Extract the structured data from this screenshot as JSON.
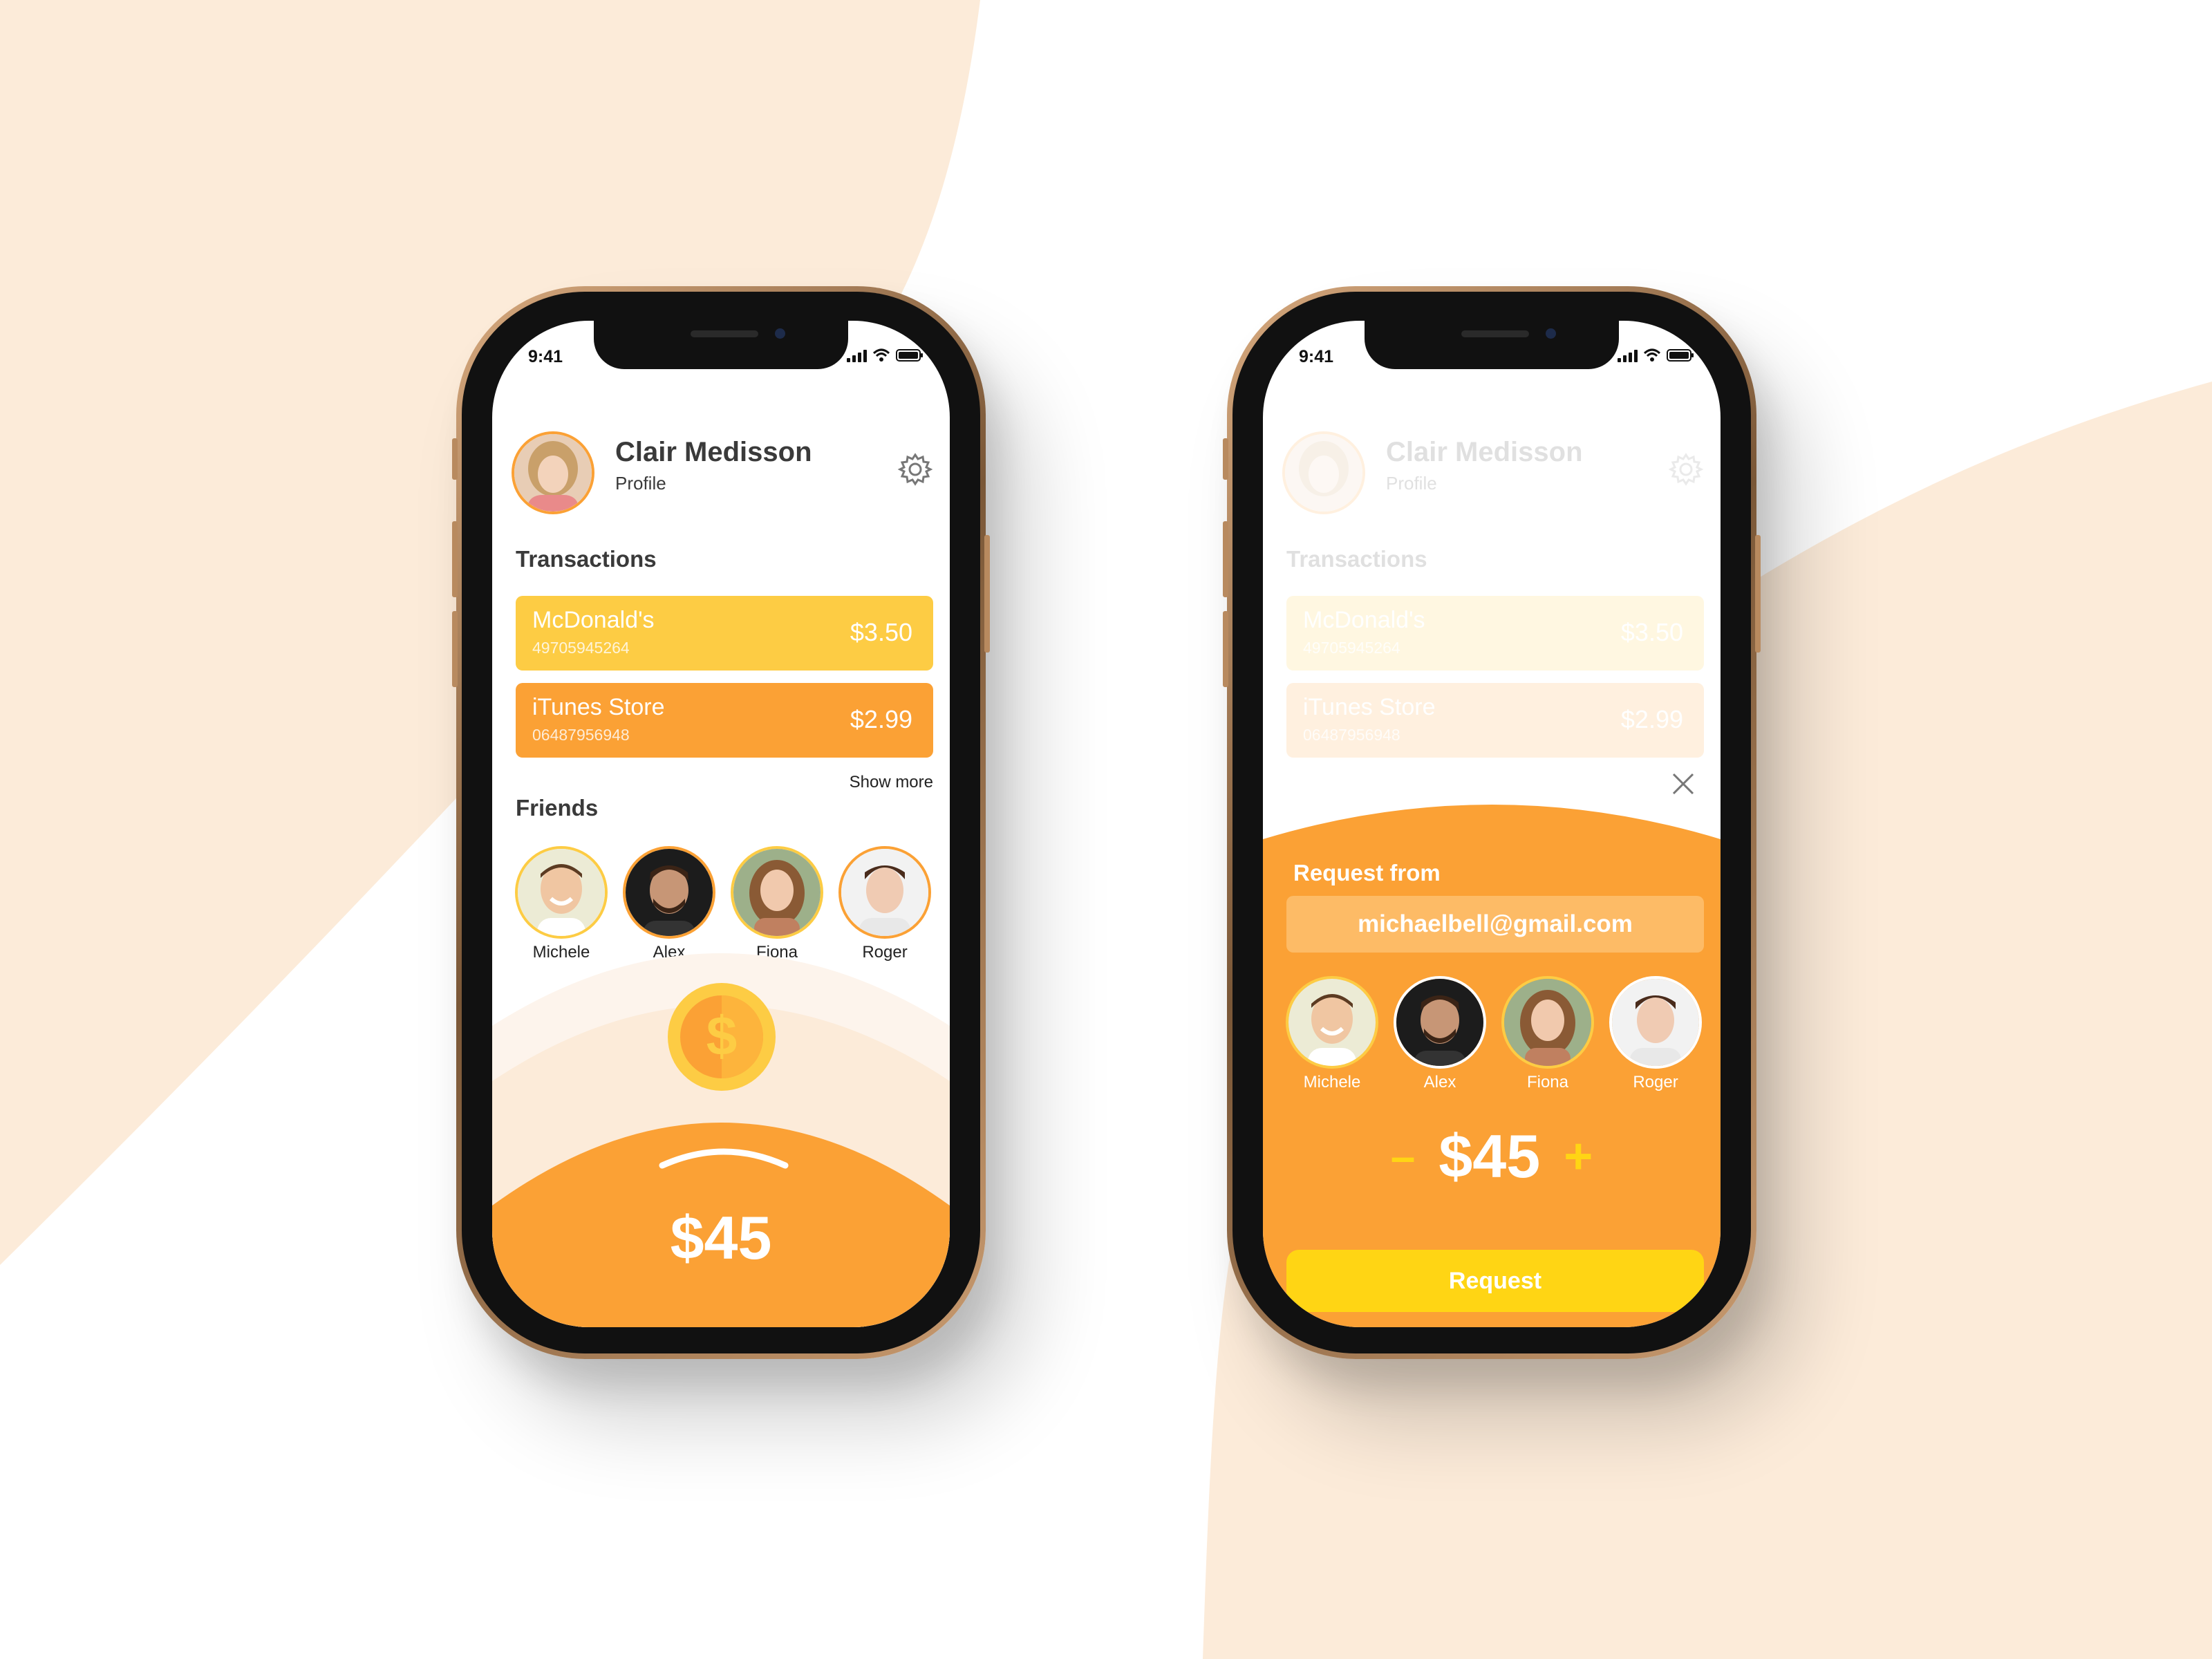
{
  "colors": {
    "accent": "#fba135",
    "yellow": "#fdcc44",
    "bright_yellow": "#ffd514",
    "bg_shape": "#fcebd9"
  },
  "status_bar": {
    "time": "9:41"
  },
  "profile": {
    "name": "Clair Medisson",
    "subtitle": "Profile",
    "settings_icon": "gear-icon"
  },
  "transactions": {
    "title": "Transactions",
    "items": [
      {
        "merchant": "McDonald's",
        "number": "49705945264",
        "amount": "$3.50"
      },
      {
        "merchant": "iTunes Store",
        "number": "06487956948",
        "amount": "$2.99"
      }
    ],
    "show_more": "Show more"
  },
  "friends": {
    "title": "Friends",
    "items": [
      {
        "name": "Michele"
      },
      {
        "name": "Alex"
      },
      {
        "name": "Fiona"
      },
      {
        "name": "Roger"
      }
    ]
  },
  "coin_icon": "dollar-coin-icon",
  "amount": "$45",
  "request": {
    "title": "Request from",
    "email": "michaelbell@gmail.com",
    "minus": "–",
    "plus": "+",
    "amount": "$45",
    "button": "Request",
    "close_icon": "close-icon"
  }
}
